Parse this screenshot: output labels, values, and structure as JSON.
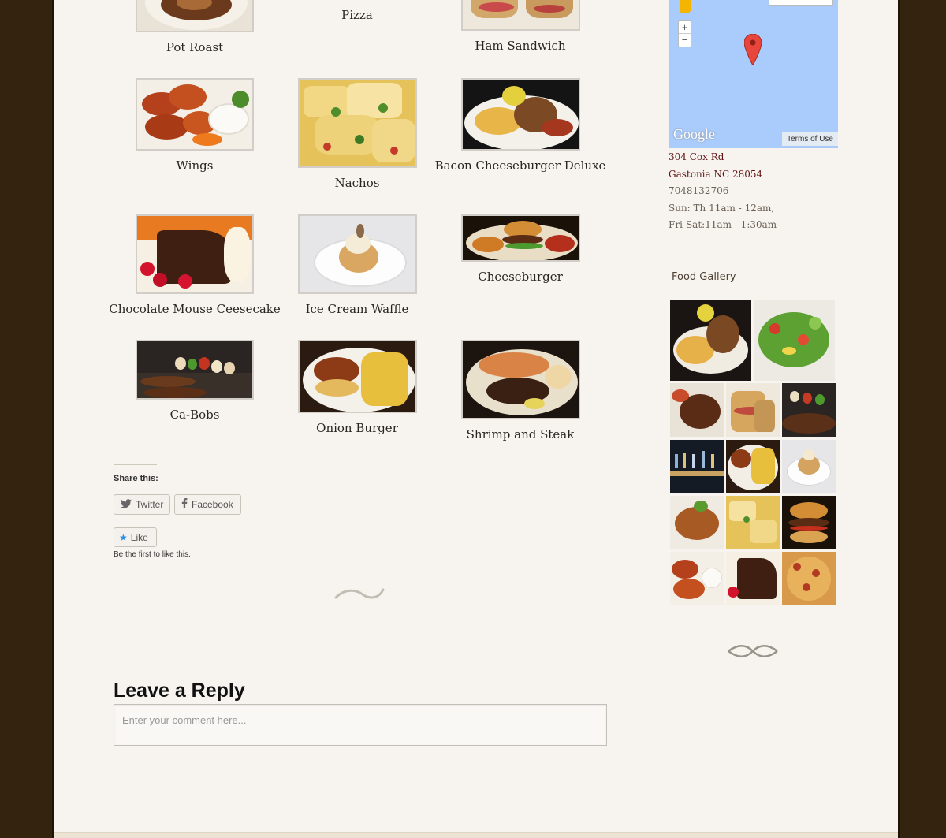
{
  "menu": {
    "items": [
      {
        "caption": "Pot Roast"
      },
      {
        "caption": "Pizza"
      },
      {
        "caption": "Ham Sandwich"
      },
      {
        "caption": "Wings"
      },
      {
        "caption": "Nachos"
      },
      {
        "caption": "Bacon Cheeseburger Deluxe"
      },
      {
        "caption": "Chocolate Mouse Ceesecake"
      },
      {
        "caption": "Ice Cream Waffle"
      },
      {
        "caption": "Cheeseburger"
      },
      {
        "caption": "Ca-Bobs"
      },
      {
        "caption": "Onion Burger"
      },
      {
        "caption": "Shrimp and Steak"
      }
    ]
  },
  "share": {
    "title": "Share this:",
    "twitter_label": "Twitter",
    "facebook_label": "Facebook",
    "like_label": "Like",
    "like_note": "Be the first to like this."
  },
  "reply": {
    "title": "Leave a Reply",
    "placeholder": "Enter your comment here..."
  },
  "sidebar": {
    "map": {
      "zoom_in": "+",
      "zoom_out": "−",
      "logo": "Google",
      "terms": "Terms of Use"
    },
    "address_line1": "304 Cox Rd",
    "address_line2": "Gastonia NC 28054",
    "phone": "7048132706",
    "hours_line1": "Sun: Th 11am - 12am,",
    "hours_line2": "Fri-Sat:11am - 1:30am",
    "gallery_title": "Food Gallery"
  },
  "colors": {
    "page_bg": "#f7f4ef",
    "outer_bg": "#33230f",
    "link": "#5e1414"
  }
}
